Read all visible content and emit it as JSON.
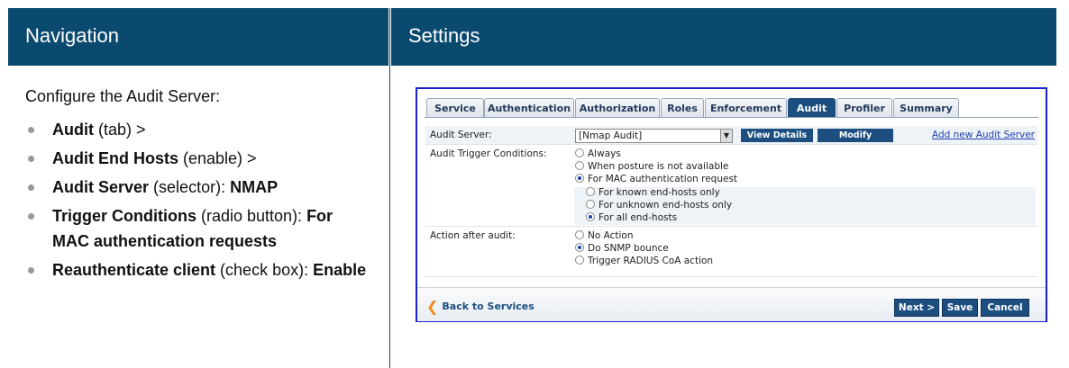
{
  "header": {
    "left_title": "Navigation",
    "right_title": "Settings"
  },
  "nav": {
    "intro": "Configure the Audit Server:",
    "items": [
      {
        "bold": "Audit",
        "rest": " (tab) >",
        "bold2": ""
      },
      {
        "bold": "Audit End Hosts",
        "rest": " (enable) >",
        "bold2": ""
      },
      {
        "bold": "Audit Server",
        "rest": " (selector): ",
        "bold2": "NMAP"
      },
      {
        "bold": "Trigger Conditions",
        "rest": " (radio button): ",
        "bold2": "For MAC authentication requests"
      },
      {
        "bold": "Reauthenticate client",
        "rest": " (check box): ",
        "bold2": "Enable"
      }
    ]
  },
  "panel": {
    "tabs": [
      "Service",
      "Authentication",
      "Authorization",
      "Roles",
      "Enforcement",
      "Audit",
      "Profiler",
      "Summary"
    ],
    "active_tab": "Audit",
    "audit_server": {
      "label": "Audit Server:",
      "selected": "[Nmap Audit]",
      "view_details": "View Details",
      "modify": "Modify",
      "add_link": "Add new Audit Server"
    },
    "trigger": {
      "label": "Audit Trigger Conditions:",
      "always": "Always",
      "posture": "When posture is not available",
      "mac": "For MAC authentication request",
      "known": "For known end-hosts only",
      "unknown": "For unknown end-hosts only",
      "all": "For all end-hosts"
    },
    "action": {
      "label": "Action after audit:",
      "none": "No Action",
      "snmp": "Do SNMP bounce",
      "coa": "Trigger RADIUS CoA action"
    },
    "footer": {
      "back": "Back to Services",
      "next": "Next >",
      "save": "Save",
      "cancel": "Cancel"
    }
  },
  "colors": {
    "header_bg": "#0b4a6f",
    "panel_border": "#1a1fd0",
    "button_bg": "#1c4f80",
    "back_chevron": "#f08a1c"
  }
}
